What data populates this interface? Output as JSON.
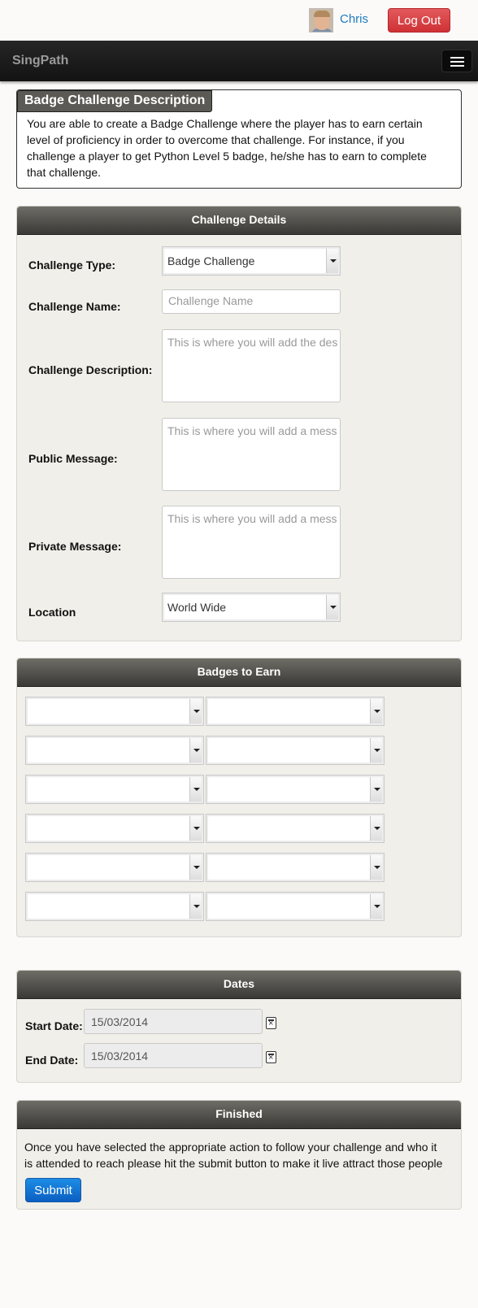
{
  "user": {
    "name": "Chris",
    "logout_label": "Log Out"
  },
  "navbar": {
    "brand": "SingPath"
  },
  "description": {
    "title": "Badge Challenge Description",
    "lines": [
      "You are able to create a Badge Challenge where the player has to earn certain",
      "level of proficiency in order to overcome that challenge. For instance, if you",
      "challenge a player to get Python Level 5 badge, he/she has to earn to complete",
      "that challenge."
    ]
  },
  "details": {
    "heading": "Challenge Details",
    "type_label": "Challenge Type:",
    "type_value": "Badge Challenge",
    "name_label": "Challenge Name:",
    "name_placeholder": "Challenge Name",
    "desc_label": "Challenge Description:",
    "desc_placeholder": "This is where you will add the des",
    "public_label": "Public Message:",
    "public_placeholder": "This is where you will add a mess",
    "private_label": "Private Message:",
    "private_placeholder": "This is where you will add a mess",
    "location_label": "Location",
    "location_value": "World Wide"
  },
  "badges": {
    "heading": "Badges to Earn"
  },
  "dates": {
    "heading": "Dates",
    "start_label": "Start Date:",
    "start_value": "15/03/2014",
    "end_label": "End Date:",
    "end_value": "15/03/2014"
  },
  "finished": {
    "heading": "Finished",
    "lines": [
      "Once you have selected the appropriate action to follow your challenge and who it",
      "is attended to reach please hit the submit button to make it live attract those people"
    ],
    "submit_label": "Submit"
  },
  "colors": {
    "accent_blue": "#0b5fc1",
    "logout_red": "#d9403f",
    "panel_header": "#4a4944"
  }
}
